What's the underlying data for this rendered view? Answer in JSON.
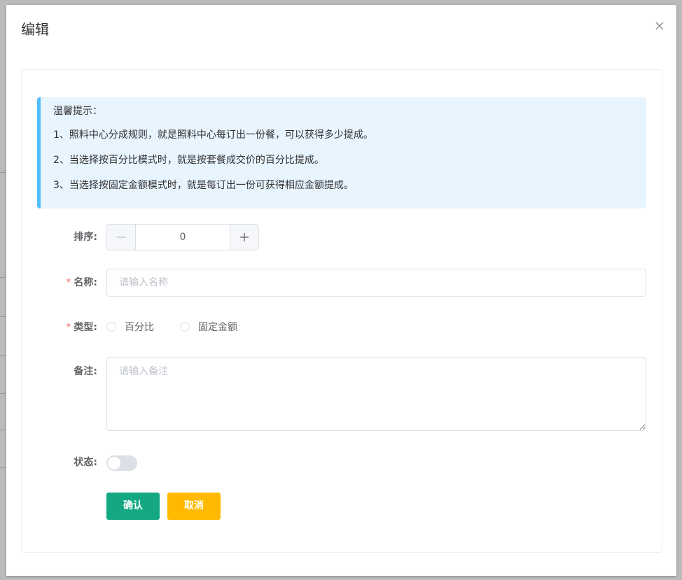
{
  "dialog": {
    "title": "编辑"
  },
  "tips": [
    "温馨提示：",
    "1、照料中心分成规则，就是照料中心每订出一份餐，可以获得多少提成。",
    "2、当选择按百分比模式时，就是按套餐成交价的百分比提成。",
    "3、当选择按固定金额模式时，就是每订出一份可获得相应金额提成。"
  ],
  "form": {
    "sort": {
      "label": "排序:",
      "value": "0"
    },
    "name": {
      "label": "名称:",
      "placeholder": "请输入名称",
      "required_mark": "*"
    },
    "type": {
      "label": "类型:",
      "required_mark": "*",
      "options": [
        "百分比",
        "固定金额"
      ]
    },
    "remark": {
      "label": "备注:",
      "placeholder": "请输入备注"
    },
    "status": {
      "label": "状态:",
      "on": false
    }
  },
  "buttons": {
    "confirm": "确认",
    "cancel": "取消"
  },
  "colors": {
    "confirm": "#13a883",
    "cancel": "#ffba00",
    "tip_background": "#e8f4fe",
    "tip_border": "#50bfff",
    "required": "#f56c6c"
  },
  "icons": {
    "close": "close-icon",
    "minus": "minus-icon",
    "plus": "plus-icon"
  }
}
